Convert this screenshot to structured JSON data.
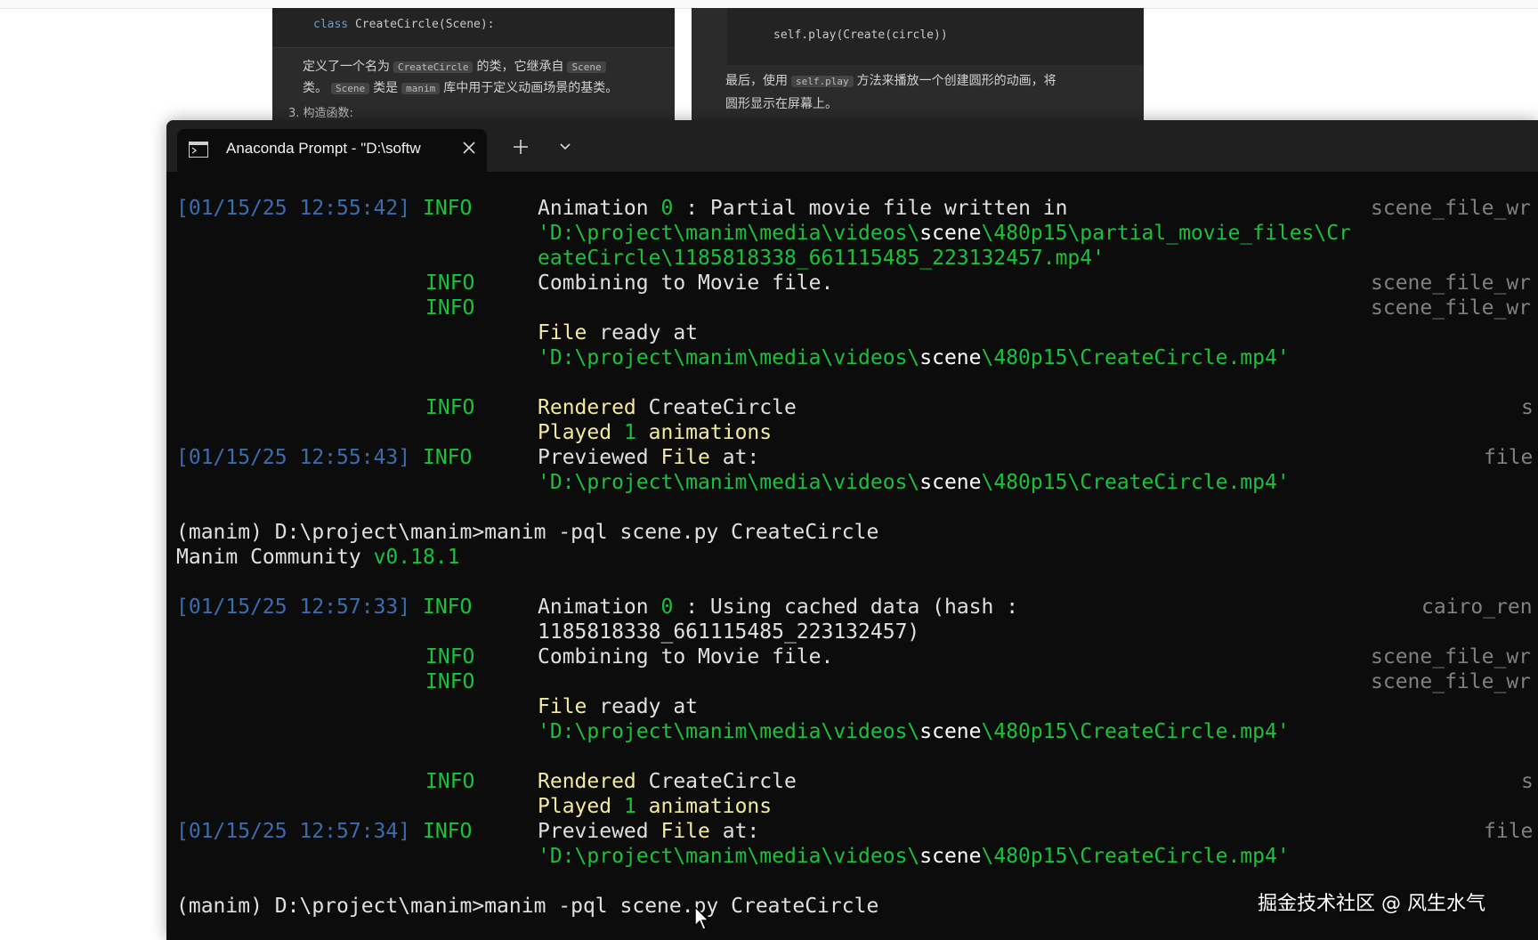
{
  "doc": {
    "left": {
      "code_keyword": "class",
      "code_rest": " CreateCircle(Scene):",
      "line1_a": "定义了一个名为",
      "line1_code1": "CreateCircle",
      "line1_b": "的类，它继承自",
      "line1_code2": "Scene",
      "line2_a": "类。",
      "line2_code1": "Scene",
      "line2_b": "类是",
      "line2_code2": "manim",
      "line2_c": "库中用于定义动画场景的基类。",
      "line3": "3. 构造函数:"
    },
    "right": {
      "code": "self.play(Create(circle))",
      "line1_a": "最后，使用",
      "line1_code": "self.play",
      "line1_b": "方法来播放一个创建圆形的动画，将",
      "line2": "圆形显示在屏幕上。"
    }
  },
  "terminal": {
    "tab_title": "Anaconda Prompt - \"D:\\softw",
    "tab_icon": "console-icon",
    "close_icon": "close-icon",
    "new_tab_icon": "plus-icon",
    "dropdown_icon": "chevron-down-icon",
    "lines": [
      {
        "ts": "[01/15/25 12:55:42]",
        "lvl": "INFO",
        "text_a": "Animation ",
        "text_num": "0",
        "text_b": " : Partial movie file written in",
        "src": "scene_file_wr"
      },
      {
        "path_a": "'D:\\project\\manim\\media\\videos\\",
        "path_w": "scene",
        "path_b": "\\480p15\\partial_movie_files\\Cr"
      },
      {
        "path_a": "eateCircle\\1185818338_661115485_223132457.mp4'"
      },
      {
        "lvl": "INFO",
        "text": "Combining to Movie file.",
        "src": "scene_file_wr"
      },
      {
        "lvl": "INFO",
        "src": "scene_file_wr"
      },
      {
        "text_a": "File",
        "text_b": " ready at"
      },
      {
        "path_a": "'D:\\project\\manim\\media\\videos\\",
        "path_w": "scene",
        "path_b": "\\480p15\\CreateCircle.mp4'"
      },
      {
        "lvl": "INFO",
        "text_a": "Rendered",
        "text_b": " CreateCircle",
        "src": "s"
      },
      {
        "text_a": "Played ",
        "text_num": "1",
        "text_b": " animations"
      },
      {
        "ts": "[01/15/25 12:55:43]",
        "lvl": "INFO",
        "text_a": "Previewed ",
        "text_w": "File",
        "text_b": " at:",
        "src": "file"
      },
      {
        "path_a": "'D:\\project\\manim\\media\\videos\\",
        "path_w": "scene",
        "path_b": "\\480p15\\CreateCircle.mp4'"
      },
      {
        "prompt": "(manim) D:\\project\\manim>manim -pql scene.py CreateCircle"
      },
      {
        "text_a": "Manim Community ",
        "ver": "v0.18.1"
      },
      {
        "ts": "[01/15/25 12:57:33]",
        "lvl": "INFO",
        "text_a": "Animation ",
        "text_num": "0",
        "text_b": " : Using cached data (hash :",
        "src": "cairo_ren"
      },
      {
        "text": "1185818338_661115485_223132457)"
      },
      {
        "lvl": "INFO",
        "text": "Combining to Movie file.",
        "src": "scene_file_wr"
      },
      {
        "lvl": "INFO",
        "src": "scene_file_wr"
      },
      {
        "text_a": "File",
        "text_b": " ready at"
      },
      {
        "path_a": "'D:\\project\\manim\\media\\videos\\",
        "path_w": "scene",
        "path_b": "\\480p15\\CreateCircle.mp4'"
      },
      {
        "lvl": "INFO",
        "text_a": "Rendered",
        "text_b": " CreateCircle",
        "src": "s"
      },
      {
        "text_a": "Played ",
        "text_num": "1",
        "text_b": " animations"
      },
      {
        "ts": "[01/15/25 12:57:34]",
        "lvl": "INFO",
        "text_a": "Previewed ",
        "text_w": "File",
        "text_b": " at:",
        "src": "file"
      },
      {
        "path_a": "'D:\\project\\manim\\media\\videos\\",
        "path_w": "scene",
        "path_b": "\\480p15\\CreateCircle.mp4'"
      },
      {
        "prompt": "(manim) D:\\project\\manim>manim -pql scene.py CreateCircle"
      }
    ]
  },
  "watermark": "掘金技术社区 @ 风生水气",
  "colors": {
    "terminal_bg": "#0c0c0c",
    "timestamp": "#3b6cae",
    "info": "#19c23a",
    "highlight": "#f2eb9b",
    "source": "#808080"
  }
}
